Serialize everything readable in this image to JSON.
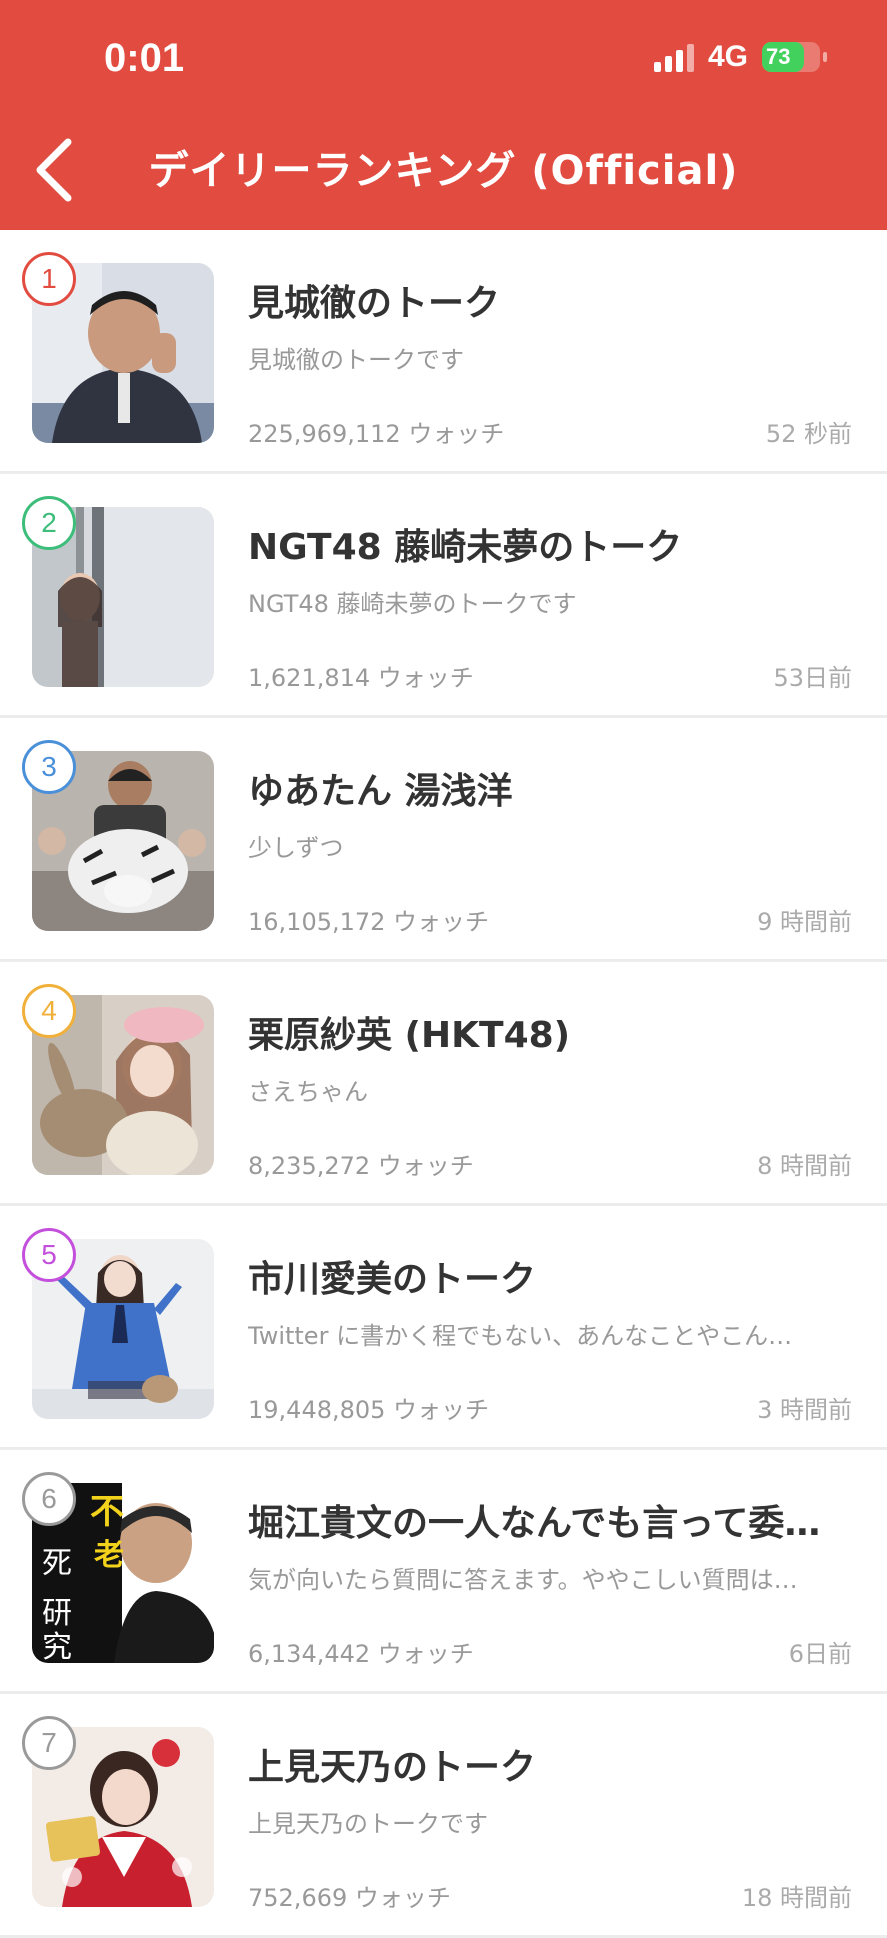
{
  "status_bar": {
    "time": "0:01",
    "network": "4G",
    "battery": "73",
    "battery_level": 0.73
  },
  "header": {
    "back_icon": "chevron-left-icon",
    "title": "デイリーランキング (Official)"
  },
  "rank_colors": [
    "#e24b3f",
    "#3dbd7a",
    "#4a90d9",
    "#f0b03a",
    "#c44fdc",
    "#9a9a9a",
    "#9a9a9a"
  ],
  "items": [
    {
      "rank": "1",
      "name": "見城徹のトーク",
      "description": "見城徹のトークです",
      "watch": "225,969,112 ウォッチ",
      "time": "52 秒前"
    },
    {
      "rank": "2",
      "name": "NGT48 藤崎未夢のトーク",
      "description": "NGT48 藤崎未夢のトークです",
      "watch": "1,621,814 ウォッチ",
      "time": "53日前"
    },
    {
      "rank": "3",
      "name": "ゆあたん 湯浅洋",
      "description": "少しずつ",
      "watch": "16,105,172 ウォッチ",
      "time": "9 時間前"
    },
    {
      "rank": "4",
      "name": "栗原紗英 (HKT48)",
      "description": "さえちゃん",
      "watch": "8,235,272 ウォッチ",
      "time": "8 時間前"
    },
    {
      "rank": "5",
      "name": "市川愛美のトーク",
      "description": "Twitter に書かく程でもない、あんなことやこん…",
      "watch": "19,448,805 ウォッチ",
      "time": "3 時間前"
    },
    {
      "rank": "6",
      "name": "堀江貴文の一人なんでも言って委…",
      "description": "気が向いたら質問に答えます。ややこしい質問は…",
      "watch": "6,134,442 ウォッチ",
      "time": "6日前"
    },
    {
      "rank": "7",
      "name": "上見天乃のトーク",
      "description": "上見天乃のトークです",
      "watch": "752,669 ウォッチ",
      "time": "18 時間前"
    }
  ]
}
